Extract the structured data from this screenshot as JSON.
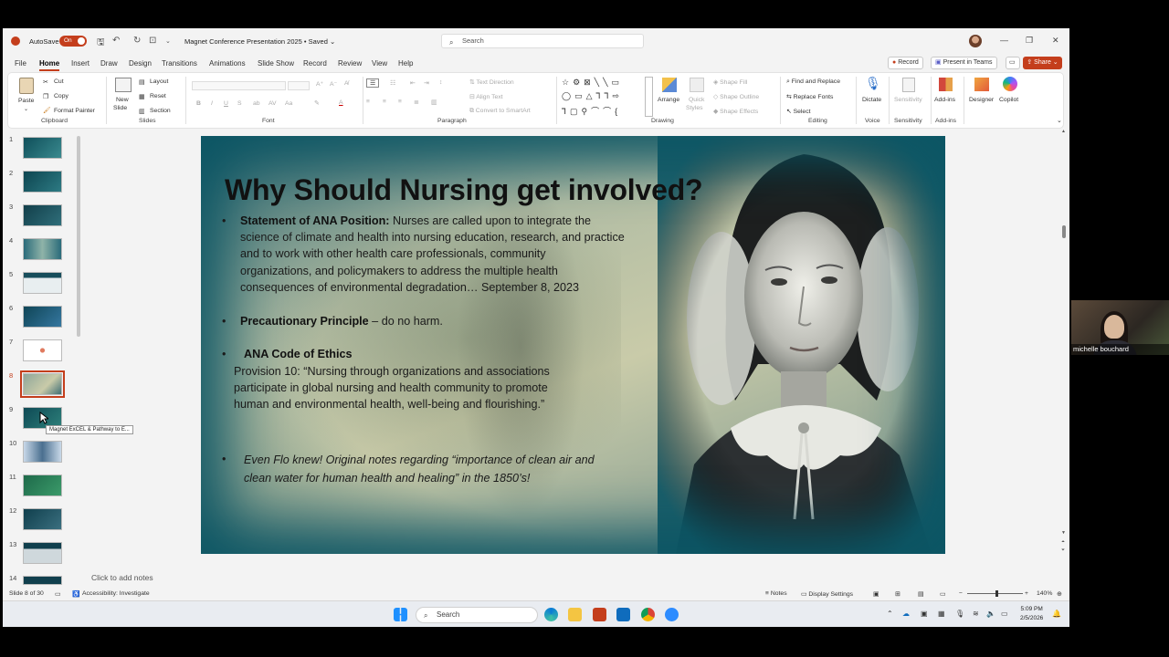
{
  "titlebar": {
    "autosave_label": "AutoSave",
    "autosave_state": "On",
    "doc_title": "Magnet Conference Presentation 2025 • Saved ⌄",
    "search_placeholder": "Search"
  },
  "menu": {
    "tabs": [
      "File",
      "Home",
      "Insert",
      "Draw",
      "Design",
      "Transitions",
      "Animations",
      "Slide Show",
      "Record",
      "Review",
      "View",
      "Help"
    ],
    "record_btn": "Record",
    "present_btn": "Present in Teams",
    "share_btn": "Share"
  },
  "ribbon": {
    "clipboard": {
      "paste": "Paste",
      "cut": "Cut",
      "copy": "Copy",
      "format_painter": "Format Painter",
      "label": "Clipboard"
    },
    "slides": {
      "new_slide": "New",
      "new_slide2": "Slide",
      "layout": "Layout",
      "reset": "Reset",
      "section": "Section",
      "label": "Slides"
    },
    "font": {
      "label": "Font"
    },
    "paragraph": {
      "text_direction": "Text Direction",
      "align_text": "Align Text",
      "smartart": "Convert to SmartArt",
      "label": "Paragraph"
    },
    "drawing": {
      "arrange": "Arrange",
      "quick_styles": "Quick",
      "quick_styles2": "Styles",
      "shape_fill": "Shape Fill",
      "shape_outline": "Shape Outline",
      "shape_effects": "Shape Effects",
      "label": "Drawing"
    },
    "editing": {
      "find_replace": "Find and Replace",
      "replace_fonts": "Replace Fonts",
      "select": "Select",
      "label": "Editing"
    },
    "voice": {
      "dictate": "Dictate",
      "label": "Voice"
    },
    "sensitivity": {
      "sensitivity": "Sensitivity",
      "label": "Sensitivity"
    },
    "addins": {
      "addins": "Add-ins",
      "label": "Add-ins"
    },
    "designer": "Designer",
    "copilot": "Copilot"
  },
  "thumbnails": {
    "numbers": [
      "1",
      "2",
      "3",
      "4",
      "5",
      "6",
      "7",
      "8",
      "9",
      "10",
      "11",
      "12",
      "13",
      "14"
    ],
    "active": "8",
    "tooltip": "Magnet ExCEL & Pathway to E..."
  },
  "slide": {
    "title": "Why Should Nursing get involved?",
    "bullet1_head": "Statement of ANA Position:",
    "bullet1_l1": " Nurses are called upon to integrate the",
    "bullet1_l2": "science of climate and health into nursing education, research, and practice",
    "bullet1_l3": "and to work with other health care professionals, community",
    "bullet1_l4": "organizations, and policymakers to address the multiple health",
    "bullet1_l5": "consequences of environmental degradation… September 8, 2023",
    "bullet2_head": "Precautionary Principle",
    "bullet2_rest": " – do no harm.",
    "bullet3_head": "ANA Code of Ethics",
    "provision_l1": "Provision 10: “Nursing through organizations and associations",
    "provision_l2": "participate in global nursing and health community to promote",
    "provision_l3": "human and environmental health, well-being and flourishing.”",
    "bullet4_l1": "Even Flo knew! Original notes regarding “importance of clean air and",
    "bullet4_l2": "clean water for human health and healing” in the 1850’s!",
    "bullet_char": "•"
  },
  "notes_placeholder": "Click to add notes",
  "status": {
    "slide_of": "Slide 8 of 30",
    "accessibility": "Accessibility: Investigate",
    "notes": "Notes",
    "display_settings": "Display Settings",
    "zoom": "140%"
  },
  "taskbar": {
    "search": "Search",
    "time": "5:09 PM",
    "date": "2/5/2026"
  },
  "video": {
    "name": "michelle bouchard"
  },
  "colors": {
    "accent": "#c43e1c",
    "slide_border": "#0c5564"
  }
}
